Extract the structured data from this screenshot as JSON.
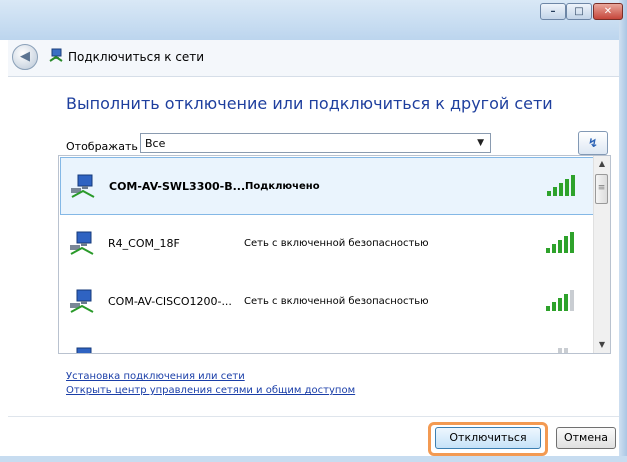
{
  "window": {
    "controls": {
      "minimize": "–",
      "maximize": "□",
      "close": "✕"
    },
    "back_glyph": "◀",
    "title": "Подключиться к сети"
  },
  "main": {
    "heading": "Выполнить отключение или подключиться к другой сети",
    "filter": {
      "label": "Отображать",
      "value": "Все"
    },
    "refresh_glyph": "↯"
  },
  "networks": [
    {
      "name": "COM-AV-SWL3300-B...",
      "status": "Подключено",
      "selected": true,
      "signal_bars": 5
    },
    {
      "name": "R4_COM_18F",
      "status": "Сеть с включенной безопасностью",
      "selected": false,
      "signal_bars": 5
    },
    {
      "name": "COM-AV-CISCO1200-...",
      "status": "Сеть с включенной безопасностью",
      "selected": false,
      "signal_bars": 4
    },
    {
      "name": "",
      "status": "",
      "selected": false,
      "signal_bars": 3
    }
  ],
  "links": {
    "setup": "Установка подключения или сети",
    "network_center": "Открыть центр управления сетями и общим доступом"
  },
  "buttons": {
    "disconnect": "Отключиться",
    "cancel": "Отмена"
  },
  "colors": {
    "heading": "#1e3f9e",
    "link": "#1a3ea8",
    "signal": "#2ea22b",
    "highlight": "#f39a52"
  }
}
